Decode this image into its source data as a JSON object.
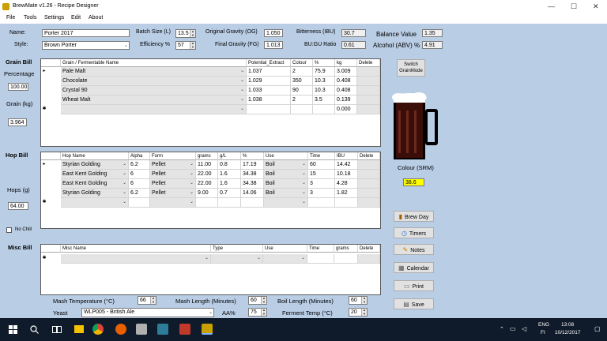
{
  "window": {
    "title": "BrewMate v1.26 - Recipe Designer",
    "minimize": "—",
    "maximize": "☐",
    "close": "✕"
  },
  "menu": [
    "File",
    "Tools",
    "Settings",
    "Edit",
    "About"
  ],
  "header": {
    "name_label": "Name:",
    "name_value": "Porter 2017",
    "style_label": "Style:",
    "style_value": "Brown Porter",
    "batch_label": "Batch Size (L)",
    "batch_value": "13.5",
    "efficiency_label": "Efficiency %",
    "efficiency_value": "57",
    "og_label": "Original Gravity (OG)",
    "og_value": "1.050",
    "fg_label": "Final Gravity (FG)",
    "fg_value": "1.013",
    "ibu_label": "Bitterness (IBU)",
    "ibu_value": "30.7",
    "bugu_label": "BU:GU Ratio",
    "bugu_value": "0.61",
    "balance_label": "Balance Value",
    "balance_value": "1.35",
    "abv_label": "Alcohol (ABV) %",
    "abv_value": "4.91"
  },
  "grain": {
    "section_label": "Grain Bill",
    "percentage_label": "Percentage",
    "percentage_value": "100.00",
    "kg_label": "Grain (kg)",
    "kg_value": "3.964",
    "columns": [
      "Grain / Fermentable Name",
      "Potential_Extract",
      "Colour",
      "%",
      "kg",
      "Delete"
    ],
    "rows": [
      {
        "name": "Pale Malt",
        "extract": "1.037",
        "colour": "2",
        "pct": "75.9",
        "kg": "3.009"
      },
      {
        "name": "Chocolate",
        "extract": "1.029",
        "colour": "350",
        "pct": "10.3",
        "kg": "0.408"
      },
      {
        "name": "Crystal 90",
        "extract": "1.033",
        "colour": "90",
        "pct": "10.3",
        "kg": "0.408"
      },
      {
        "name": "Wheat Malt",
        "extract": "1.038",
        "colour": "2",
        "pct": "3.5",
        "kg": "0.139"
      }
    ],
    "new_row_kg": "0.000",
    "switch_button": "Switch GrainMode"
  },
  "hops": {
    "section_label": "Hop Bill",
    "hops_label": "Hops (g)",
    "hops_value": "64.00",
    "nochill_label": "No Chill",
    "columns": [
      "Hop Name",
      "Alpha",
      "Form",
      "grams",
      "g/L",
      "%",
      "Use",
      "Time",
      "IBU",
      "Delete"
    ],
    "rows": [
      {
        "name": "Styrian Golding",
        "alpha": "6.2",
        "form": "Pellet",
        "grams": "11.00",
        "gl": "0.8",
        "pct": "17.19",
        "use": "Boil",
        "time": "60",
        "ibu": "14.42"
      },
      {
        "name": "East Kent Golding",
        "alpha": "6",
        "form": "Pellet",
        "grams": "22.00",
        "gl": "1.6",
        "pct": "34.38",
        "use": "Boil",
        "time": "15",
        "ibu": "10.18"
      },
      {
        "name": "East Kent Golding",
        "alpha": "6",
        "form": "Pellet",
        "grams": "22.00",
        "gl": "1.6",
        "pct": "34.38",
        "use": "Boil",
        "time": "3",
        "ibu": "4.28"
      },
      {
        "name": "Styrian Golding",
        "alpha": "6.2",
        "form": "Pellet",
        "grams": "9.00",
        "gl": "0.7",
        "pct": "14.06",
        "use": "Boil",
        "time": "3",
        "ibu": "1.82"
      }
    ]
  },
  "misc": {
    "section_label": "Misc Bill",
    "columns": [
      "Misc Name",
      "Type",
      "Use",
      "Time",
      "grams",
      "Delete"
    ]
  },
  "colour": {
    "label": "Colour (SRM)",
    "value": "38.6",
    "beer_color": "#3a0d08"
  },
  "buttons": {
    "brew_day": "Brew Day",
    "timers": "Timers",
    "notes": "Notes",
    "calendar": "Calendar",
    "print": "Print",
    "save": "Save"
  },
  "bottom": {
    "mash_temp_label": "Mash Temperature (°C)",
    "mash_temp_value": "66",
    "mash_length_label": "Mash Length (Minutes)",
    "mash_length_value": "60",
    "boil_length_label": "Boil Length (Minutes)",
    "boil_length_value": "60",
    "yeast_label": "Yeast",
    "yeast_value": "WLP005 - British Ale",
    "aa_label": "AA%",
    "aa_value": "75",
    "ferment_label": "Ferment Temp (°C)",
    "ferment_value": "20"
  },
  "taskbar": {
    "lang": "ENG",
    "region": "FI",
    "time": "13:08",
    "date": "10/12/2017"
  }
}
